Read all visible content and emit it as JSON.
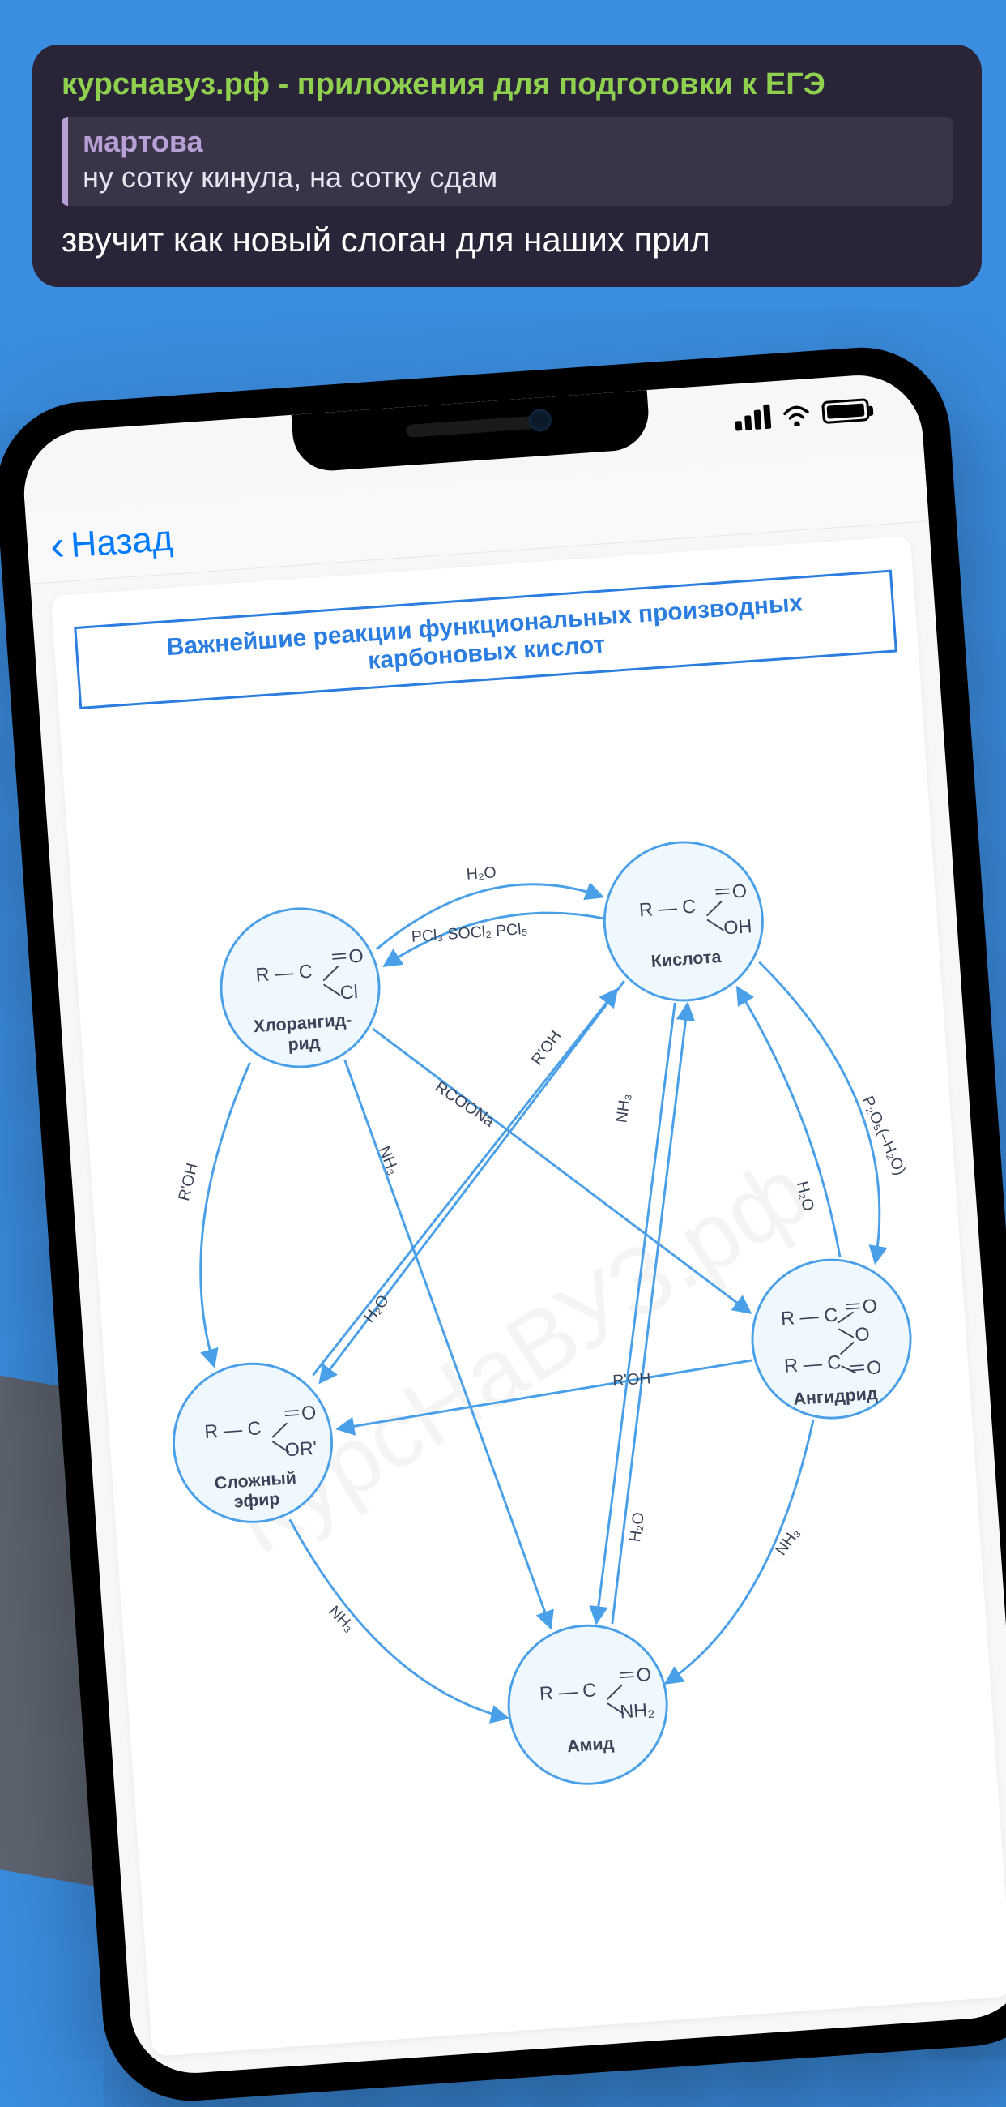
{
  "chat": {
    "title": "курснавуз.рф - приложения для подготовки к ЕГЭ",
    "quote_author": "мартова",
    "quote_text": "ну сотку кинула, на сотку сдам",
    "message": "звучит как новый слоган для наших прил"
  },
  "nav": {
    "back_label": "Назад"
  },
  "content": {
    "title": "Важнейшие реакции функциональных производных карбоновых кислот",
    "watermark": "КурсНаВУЗ.рф"
  },
  "diagram": {
    "nodes": [
      {
        "id": "acid",
        "label": "Кислота",
        "formula_lines": [
          "R — C",
          "= O",
          "OH"
        ]
      },
      {
        "id": "chloride",
        "label": "Хлорангид-\nрид",
        "formula_lines": [
          "R — C",
          "= O",
          "Cl"
        ]
      },
      {
        "id": "anhydride",
        "label": "Ангидрид",
        "formula_lines": [
          "R — C = O",
          "O",
          "R — C = O"
        ]
      },
      {
        "id": "ester",
        "label": "Сложный\nэфир",
        "formula_lines": [
          "R — C",
          "= O",
          "OR'"
        ]
      },
      {
        "id": "amide",
        "label": "Амид",
        "formula_lines": [
          "R — C",
          "= O",
          "NH₂"
        ]
      }
    ],
    "edge_labels": {
      "chloride_to_acid": "H₂O",
      "acid_to_chloride": "PCl₃  SOCl₂  PCl₅",
      "acid_to_anhydride": "P₂O₅(–H₂O)",
      "anhydride_to_acid": "H₂O",
      "chloride_to_ester": "R'OH",
      "chloride_to_amide": "NH₃",
      "chloride_salt": "RCOONa",
      "acid_to_ester": "R'OH",
      "acid_to_amide": "NH₃",
      "ester_to_acid": "H₂O",
      "anhydride_to_ester": "R'OH",
      "anhydride_to_amide": "NH₃",
      "amide_to_acid": "H₂O",
      "ester_to_amide": "NH₃"
    }
  }
}
